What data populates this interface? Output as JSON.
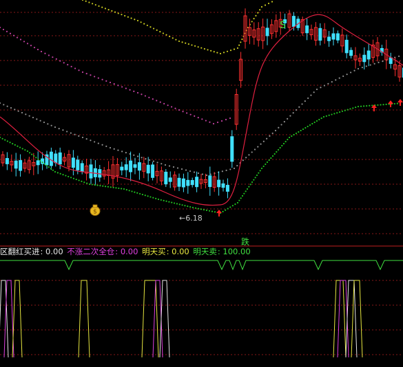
{
  "chart_data": [
    {
      "type": "line",
      "panel": "main",
      "annotations": {
        "low_price_label": "6.18",
        "top_signal_glyph": "S",
        "bottom_signal_label": "跌"
      },
      "colors": {
        "bull_candle": "#ff3030",
        "bear_candle": "#40e0ff",
        "ma_line": "#e02040",
        "support_dots": "#20c020",
        "band_dots_yellow": "#c8c820",
        "band_dots_pink": "#c040a0",
        "band_dots_grey": "#909090",
        "grid": "#8a1818"
      }
    },
    {
      "type": "line",
      "panel": "indicator",
      "legend": [
        {
          "name": "区翻红买进",
          "value": "0.00",
          "color": "#e8e8e8"
        },
        {
          "name": "不涨二次全仓",
          "value": "0.00",
          "color": "#e040e0"
        },
        {
          "name": "明天买",
          "value": "0.00",
          "color": "#e8e840"
        },
        {
          "name": "明天卖",
          "value": "100.00",
          "color": "#40e040"
        }
      ]
    }
  ]
}
